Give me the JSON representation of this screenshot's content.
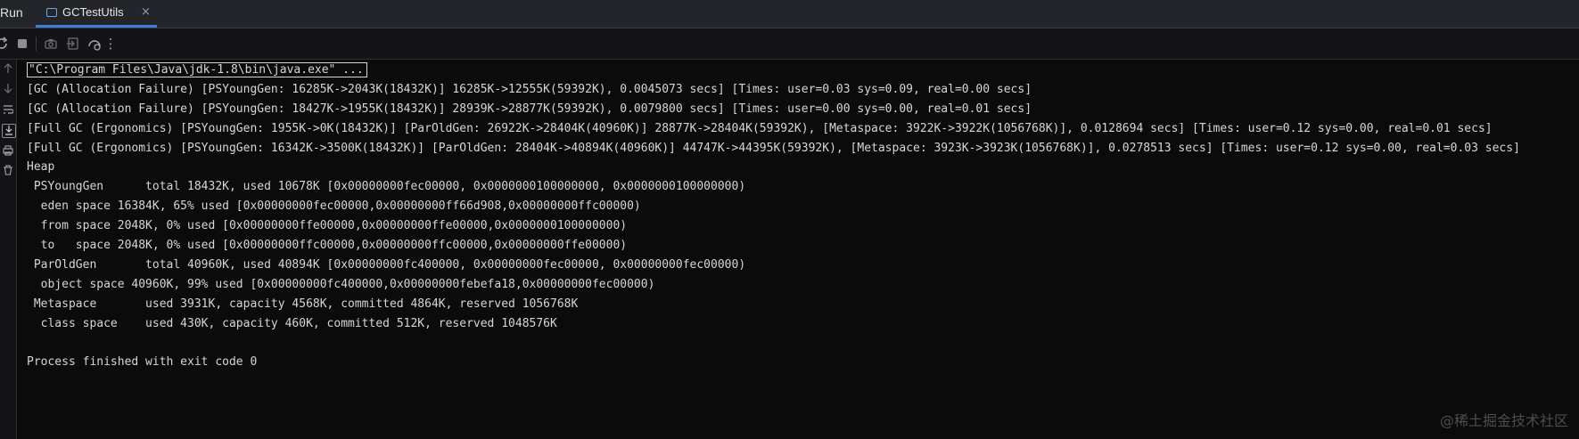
{
  "tabbar": {
    "run_label": "Run",
    "tab_title": "GCTestUtils",
    "tab_close": "×"
  },
  "toolbar": {
    "icons": [
      "rerun-icon",
      "stop-icon",
      "camera-icon",
      "import-icon",
      "settings-icon",
      "more-icon"
    ],
    "more_glyph": "⋮"
  },
  "gutter": {
    "icons": [
      "up-arrow-icon",
      "down-arrow-icon",
      "soft-wrap-icon",
      "scroll-to-end-icon",
      "print-icon",
      "trash-icon"
    ]
  },
  "console": {
    "lines": [
      "\"C:\\Program Files\\Java\\jdk-1.8\\bin\\java.exe\" ...",
      "[GC (Allocation Failure) [PSYoungGen: 16285K->2043K(18432K)] 16285K->12555K(59392K), 0.0045073 secs] [Times: user=0.03 sys=0.09, real=0.00 secs]",
      "[GC (Allocation Failure) [PSYoungGen: 18427K->1955K(18432K)] 28939K->28877K(59392K), 0.0079800 secs] [Times: user=0.00 sys=0.00, real=0.01 secs]",
      "[Full GC (Ergonomics) [PSYoungGen: 1955K->0K(18432K)] [ParOldGen: 26922K->28404K(40960K)] 28877K->28404K(59392K), [Metaspace: 3922K->3922K(1056768K)], 0.0128694 secs] [Times: user=0.12 sys=0.00, real=0.01 secs]",
      "[Full GC (Ergonomics) [PSYoungGen: 16342K->3500K(18432K)] [ParOldGen: 28404K->40894K(40960K)] 44747K->44395K(59392K), [Metaspace: 3923K->3923K(1056768K)], 0.0278513 secs] [Times: user=0.12 sys=0.00, real=0.03 secs]",
      "Heap",
      " PSYoungGen      total 18432K, used 10678K [0x00000000fec00000, 0x0000000100000000, 0x0000000100000000)",
      "  eden space 16384K, 65% used [0x00000000fec00000,0x00000000ff66d908,0x00000000ffc00000)",
      "  from space 2048K, 0% used [0x00000000ffe00000,0x00000000ffe00000,0x0000000100000000)",
      "  to   space 2048K, 0% used [0x00000000ffc00000,0x00000000ffc00000,0x00000000ffe00000)",
      " ParOldGen       total 40960K, used 40894K [0x00000000fc400000, 0x00000000fec00000, 0x00000000fec00000)",
      "  object space 40960K, 99% used [0x00000000fc400000,0x00000000febefa18,0x00000000fec00000)",
      " Metaspace       used 3931K, capacity 4568K, committed 4864K, reserved 1056768K",
      "  class space    used 430K, capacity 460K, committed 512K, reserved 1048576K",
      "",
      "Process finished with exit code 0"
    ]
  },
  "watermark": "@稀土掘金技术社区"
}
